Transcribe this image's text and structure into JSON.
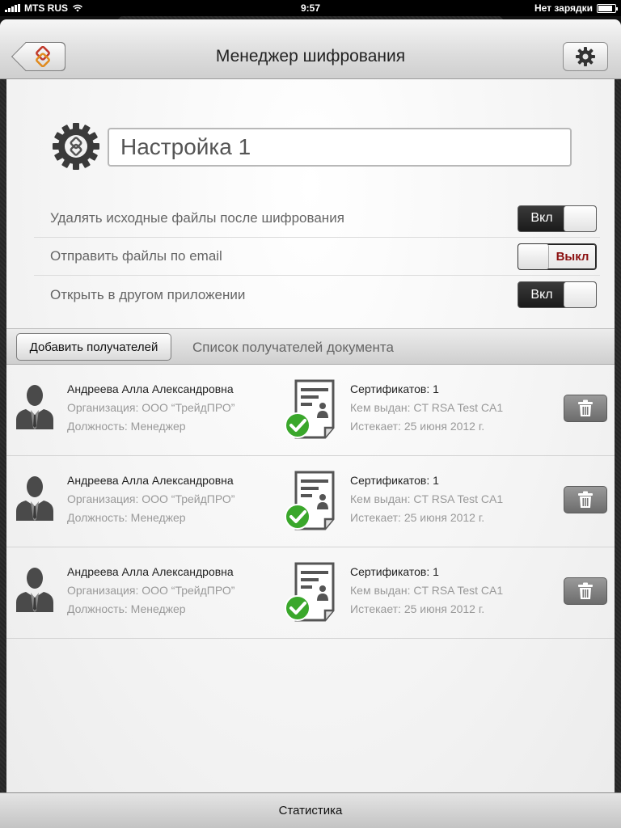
{
  "status_bar": {
    "carrier": "MTS RUS",
    "time": "9:57",
    "charging": "Нет зарядки",
    "battery_level": 0.85
  },
  "nav": {
    "title": "Менеджер шифрования",
    "back_icon": "app-logo-icon",
    "settings_icon": "gear-icon"
  },
  "profile": {
    "name": "Настройка 1",
    "icon": "settings-gear-icon"
  },
  "options": [
    {
      "label": "Удалять исходные файлы после шифрования",
      "state": "on",
      "toggle_text": "Вкл"
    },
    {
      "label": "Отправить файлы по email",
      "state": "off",
      "toggle_text": "Выкл"
    },
    {
      "label": "Открыть в другом приложении",
      "state": "on",
      "toggle_text": "Вкл"
    }
  ],
  "recipients": {
    "add_button": "Добавить получателей",
    "title": "Список получателей документа",
    "items": [
      {
        "name": "Андреева Алла Александровна",
        "organization": "Организация: ООО “ТрейдПРО”",
        "position": "Должность: Менеджер",
        "certificates": "Сертификатов: 1",
        "issuer": "Кем выдан: CT RSA Test CA1",
        "expires": "Истекает: 25 июня 2012 г."
      },
      {
        "name": "Андреева Алла Александровна",
        "organization": "Организация: ООО “ТрейдПРО”",
        "position": "Должность: Менеджер",
        "certificates": "Сертификатов: 1",
        "issuer": "Кем выдан: CT RSA Test CA1",
        "expires": "Истекает: 25 июня 2012 г."
      },
      {
        "name": "Андреева Алла Александровна",
        "organization": "Организация: ООО “ТрейдПРО”",
        "position": "Должность: Менеджер",
        "certificates": "Сертификатов: 1",
        "issuer": "Кем выдан: CT RSA Test CA1",
        "expires": "Истекает: 25 июня 2012 г."
      }
    ]
  },
  "tab_bar": {
    "label": "Статистика"
  },
  "colors": {
    "toggle_off_text": "#8b1010",
    "check_green": "#3aa72b",
    "frame": "#2a2a2a"
  }
}
